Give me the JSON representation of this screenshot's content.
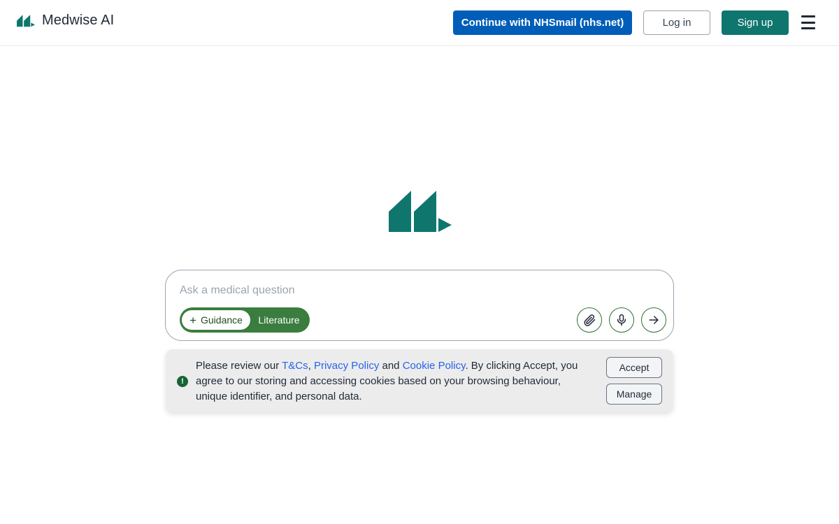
{
  "header": {
    "brand_name": "Medwise AI",
    "nhs_button": "Continue with NHSmail (nhs.net)",
    "login_button": "Log in",
    "signup_button": "Sign up"
  },
  "search": {
    "placeholder": "Ask a medical question",
    "modes": {
      "active_label": "Guidance",
      "inactive_label": "Literature"
    }
  },
  "cookie_banner": {
    "text_prefix": "Please review our ",
    "link_tcs": "T&Cs",
    "sep1": ", ",
    "link_privacy": "Privacy Policy",
    "sep2": " and ",
    "link_cookie": "Cookie Policy",
    "text_suffix": ". By clicking Accept, you agree to our storing and accessing cookies based on your browsing behaviour, unique identifier, and personal data.",
    "accept_button": "Accept",
    "manage_button": "Manage",
    "icon_glyph": "!"
  },
  "colors": {
    "brand": "#0f766e",
    "nhs_blue": "#005eb8",
    "mode_green": "#3a7d3e",
    "link_blue": "#2563eb"
  },
  "icons": {
    "brand": "medwise-logo-icon",
    "menu": "hamburger-menu-icon",
    "attach": "paperclip-icon",
    "mic": "microphone-icon",
    "send": "arrow-right-icon",
    "cookie_info": "exclamation-circle-icon"
  }
}
